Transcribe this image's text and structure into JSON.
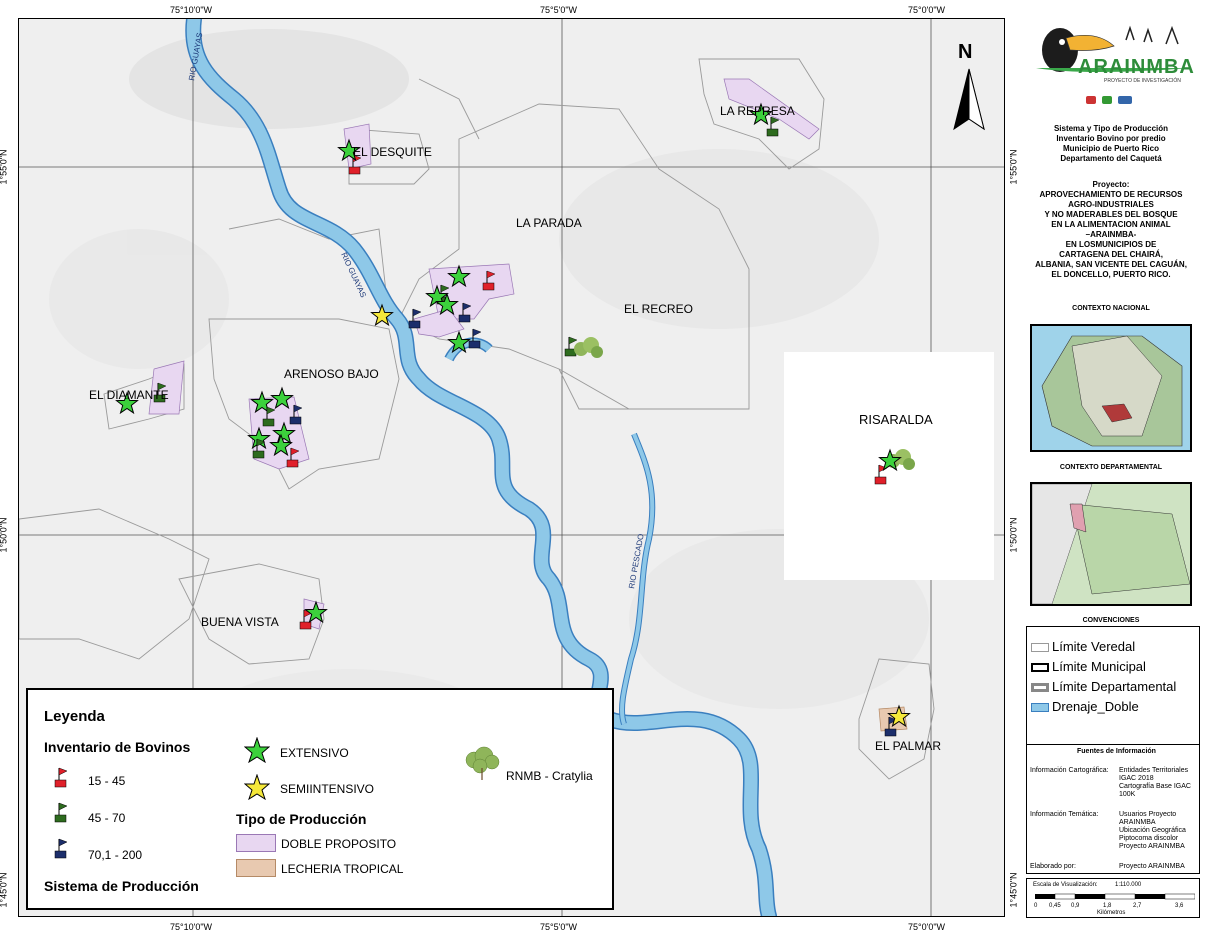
{
  "map": {
    "coords_top": [
      "75°10'0\"W",
      "75°5'0\"W",
      "75°0'0\"W"
    ],
    "coords_bottom": [
      "75°10'0\"W",
      "75°5'0\"W",
      "75°0'0\"W"
    ],
    "coords_left": [
      "1°55'0\"N",
      "1°50'0\"N",
      "1°45'0\"N"
    ],
    "coords_right": [
      "1°55'0\"N",
      "1°50'0\"N",
      "1°45'0\"N"
    ],
    "veredas": [
      "EL DESQUITE",
      "LA PARADA",
      "EL RECREO",
      "ARENOSO BAJO",
      "EL DIAMANTE",
      "BUENA VISTA",
      "LA REPRESA",
      "RISARALDA",
      "EL PALMAR"
    ],
    "rivers": [
      "RIO GUAYAS",
      "RIO GUAYAS",
      "RIO PESCADO"
    ],
    "north_label": "N",
    "colors": {
      "river": "#8ec8e8",
      "river_edge": "#3a7fbf",
      "doble": "#e8d7f1",
      "lecheria": "#e8c9b0",
      "extensivo": "#3cd13c",
      "semi": "#f5e83a",
      "flag_red": "#e0202a",
      "flag_green": "#2d6b1e",
      "flag_blue": "#1c2e6b"
    }
  },
  "legend": {
    "title": "Leyenda",
    "inventario_title": "Inventario de Bovinos",
    "inventario_items": [
      "15 - 45",
      "45 - 70",
      "70,1 - 200"
    ],
    "sistema_title": "Sistema de Producción",
    "sistema_items": [
      "EXTENSIVO",
      "SEMIINTENSIVO"
    ],
    "tipo_title": "Tipo de Producción",
    "tipo_items": [
      "DOBLE PROPOSITO",
      "LECHERIA TROPICAL"
    ],
    "rnmb": "RNMB - Cratylia"
  },
  "panel": {
    "logo_text": "ARAINMBA",
    "logo_sub": "PROYECTO DE INVESTIGACIÓN",
    "title_lines": [
      "Sistema y Tipo de Producción",
      "Inventario Bovino por predio",
      "Municipio de Puerto Rico",
      "Departamento del Caquetá"
    ],
    "project_lines": [
      "Proyecto:",
      "APROVECHAMIENTO DE RECURSOS",
      "AGRO-INDUSTRIALES",
      "Y NO MADERABLES DEL BOSQUE",
      "EN LA ALIMENTACION ANIMAL",
      "–ARAINMBA-",
      "EN LOSMUNICIPIOS DE",
      "CARTAGENA DEL CHAIRÁ,",
      "ALBANIA, SAN VICENTE DEL CAGUÁN,",
      "EL DONCELLO, PUERTO RICO."
    ],
    "contexto_nacional": "CONTEXTO NACIONAL",
    "contexto_departamental": "CONTEXTO DEPARTAMENTAL",
    "convenciones_title": "CONVENCIONES",
    "convenciones": [
      "Límite Veredal",
      "Límite Municipal",
      "Límite Departamental",
      "Drenaje_Doble"
    ],
    "fuentes_title": "Fuentes de Información",
    "fuentes_cart_label": "Información Cartográfica:",
    "fuentes_cart_values": [
      "Entidades Territoriales",
      "IGAC 2018",
      "Cartografía Base IGAC",
      "100K"
    ],
    "fuentes_tem_label": "Información Temática:",
    "fuentes_tem_values": [
      "Usuarios Proyecto",
      "ARAINMBA",
      "Ubicación Geográfica",
      "Piptocoma discolor",
      "Proyecto ARAINMBA"
    ],
    "elaborado_label": "Elaborado por:",
    "elaborado_value": "Proyecto ARAINMBA",
    "escala_label": "Escala de Visualización:",
    "escala_value": "1:110.000",
    "scale_ticks": [
      "0",
      "0,45",
      "0,9",
      "1,8",
      "2,7",
      "3,6"
    ],
    "scale_unit": "Kilómetros"
  }
}
